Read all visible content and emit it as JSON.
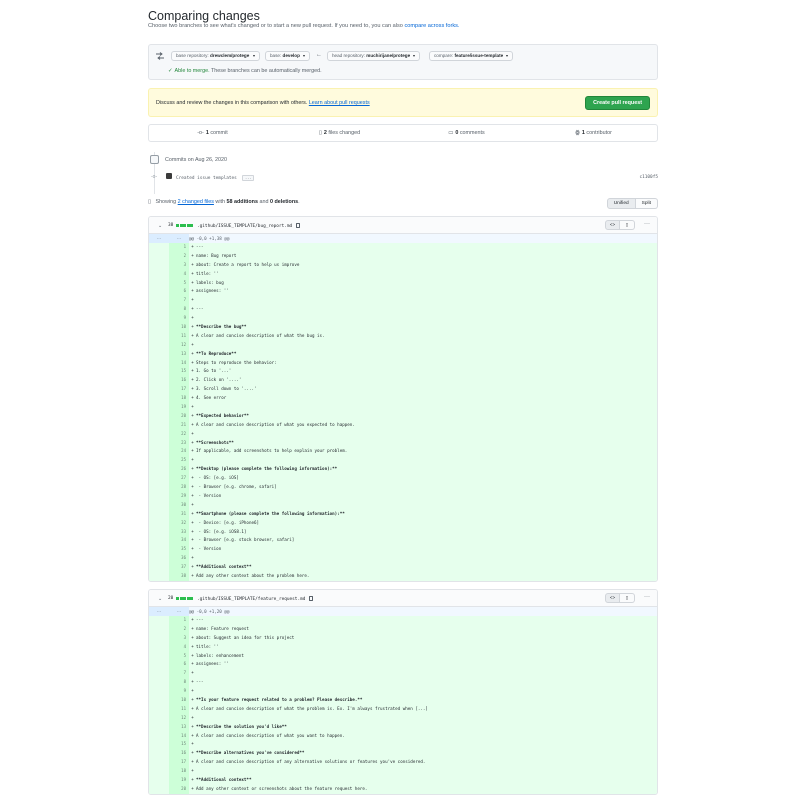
{
  "header": {
    "title": "Comparing changes",
    "subtitle": "Choose two branches to see what’s changed or to start a new pull request. If you need to, you can also",
    "subtitle_link": "compare across forks."
  },
  "range": {
    "base_repo_key": "base repository:",
    "base_repo_val": "drewclem/protege",
    "base_key": "base:",
    "base_val": "develop",
    "head_repo_key": "head repository:",
    "head_repo_val": "muchirijane/protege",
    "compare_key": "compare:",
    "compare_val": "feature/issue-template",
    "merge_ok": "Able to merge.",
    "merge_note": "These branches can be automatically merged."
  },
  "banner": {
    "text": "Discuss and review the changes in this comparison with others.",
    "link": "Learn about pull requests",
    "button": "Create pull request"
  },
  "numbers": {
    "commits_count": "1",
    "commits_label": "commit",
    "files_count": "2",
    "files_label": "files changed",
    "comments_count": "0",
    "comments_label": "comments",
    "contrib_count": "1",
    "contrib_label": "contributor"
  },
  "commits": {
    "date": "Commits on Aug 26, 2020",
    "message": "Created issue templates",
    "more": "...",
    "sha": "c1100f5"
  },
  "toc": {
    "prefix": "Showing",
    "files_link": "2 changed files",
    "with": "with",
    "additions": "58 additions",
    "and": "and",
    "deletions": "0 deletions",
    "end": ".",
    "unified": "Unified",
    "split": "Split"
  },
  "files": [
    {
      "count": "38",
      "path": ".github/ISSUE_TEMPLATE/bug_report.md",
      "hunk_left": "...",
      "hunk_right": "...",
      "hunk": "@@ -0,0 +1,38 @@",
      "lines": [
        {
          "n": "1",
          "t": "---"
        },
        {
          "n": "2",
          "t": "name: Bug report"
        },
        {
          "n": "3",
          "t": "about: Create a report to help us improve"
        },
        {
          "n": "4",
          "t": "title: ''"
        },
        {
          "n": "5",
          "t": "labels: bug"
        },
        {
          "n": "6",
          "t": "assignees: ''"
        },
        {
          "n": "7",
          "t": ""
        },
        {
          "n": "8",
          "t": "---"
        },
        {
          "n": "9",
          "t": ""
        },
        {
          "n": "10",
          "t": "**Describe the bug**"
        },
        {
          "n": "11",
          "t": "A clear and concise description of what the bug is."
        },
        {
          "n": "12",
          "t": ""
        },
        {
          "n": "13",
          "t": "**To Reproduce**"
        },
        {
          "n": "14",
          "t": "Steps to reproduce the behavior:"
        },
        {
          "n": "15",
          "t": "1. Go to '...'"
        },
        {
          "n": "16",
          "t": "2. Click on '....'"
        },
        {
          "n": "17",
          "t": "3. Scroll down to '....'"
        },
        {
          "n": "18",
          "t": "4. See error"
        },
        {
          "n": "19",
          "t": ""
        },
        {
          "n": "20",
          "t": "**Expected behavior**"
        },
        {
          "n": "21",
          "t": "A clear and concise description of what you expected to happen."
        },
        {
          "n": "22",
          "t": ""
        },
        {
          "n": "23",
          "t": "**Screenshots**"
        },
        {
          "n": "24",
          "t": "If applicable, add screenshots to help explain your problem."
        },
        {
          "n": "25",
          "t": ""
        },
        {
          "n": "26",
          "t": "**Desktop (please complete the following information):**"
        },
        {
          "n": "27",
          "t": " - OS: [e.g. iOS]"
        },
        {
          "n": "28",
          "t": " - Browser [e.g. chrome, safari]"
        },
        {
          "n": "29",
          "t": " - Version"
        },
        {
          "n": "30",
          "t": ""
        },
        {
          "n": "31",
          "t": "**Smartphone (please complete the following information):**"
        },
        {
          "n": "32",
          "t": " - Device: [e.g. iPhone6]"
        },
        {
          "n": "33",
          "t": " - OS: [e.g. iOS8.1]"
        },
        {
          "n": "34",
          "t": " - Browser [e.g. stock browser, safari]"
        },
        {
          "n": "35",
          "t": " - Version"
        },
        {
          "n": "36",
          "t": ""
        },
        {
          "n": "37",
          "t": "**Additional context**"
        },
        {
          "n": "38",
          "t": "Add any other context about the problem here."
        }
      ]
    },
    {
      "count": "20",
      "path": ".github/ISSUE_TEMPLATE/feature_request.md",
      "hunk_left": "...",
      "hunk_right": "...",
      "hunk": "@@ -0,0 +1,20 @@",
      "lines": [
        {
          "n": "1",
          "t": "---"
        },
        {
          "n": "2",
          "t": "name: Feature request"
        },
        {
          "n": "3",
          "t": "about: Suggest an idea for this project"
        },
        {
          "n": "4",
          "t": "title: ''"
        },
        {
          "n": "5",
          "t": "labels: enhancement"
        },
        {
          "n": "6",
          "t": "assignees: ''"
        },
        {
          "n": "7",
          "t": ""
        },
        {
          "n": "8",
          "t": "---"
        },
        {
          "n": "9",
          "t": ""
        },
        {
          "n": "10",
          "t": "**Is your feature request related to a problem? Please describe.**"
        },
        {
          "n": "11",
          "t": "A clear and concise description of what the problem is. Ex. I'm always frustrated when [...]"
        },
        {
          "n": "12",
          "t": ""
        },
        {
          "n": "13",
          "t": "**Describe the solution you'd like**"
        },
        {
          "n": "14",
          "t": "A clear and concise description of what you want to happen."
        },
        {
          "n": "15",
          "t": ""
        },
        {
          "n": "16",
          "t": "**Describe alternatives you've considered**"
        },
        {
          "n": "17",
          "t": "A clear and concise description of any alternative solutions or features you've considered."
        },
        {
          "n": "18",
          "t": ""
        },
        {
          "n": "19",
          "t": "**Additional context**"
        },
        {
          "n": "20",
          "t": "Add any other context or screenshots about the feature request here."
        }
      ]
    }
  ]
}
